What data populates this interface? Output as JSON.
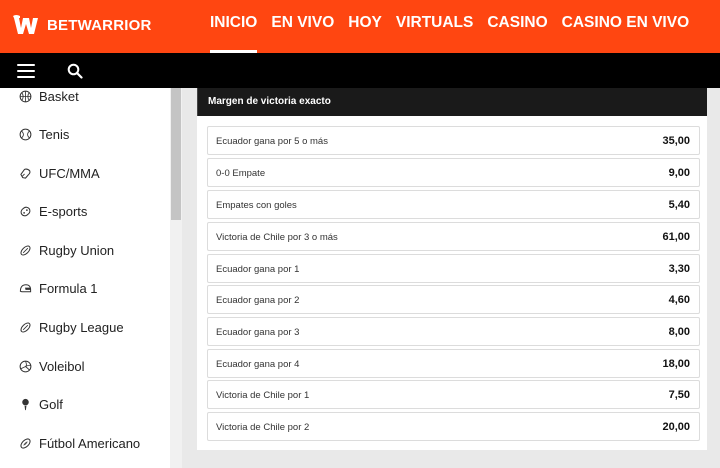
{
  "header": {
    "brand": "BETWARRIOR",
    "nav": [
      {
        "label": "INICIO",
        "active": true
      },
      {
        "label": "EN VIVO",
        "active": false
      },
      {
        "label": "HOY",
        "active": false
      },
      {
        "label": "VIRTUALS",
        "active": false
      },
      {
        "label": "CASINO",
        "active": false
      },
      {
        "label": "CASINO EN VIVO",
        "active": false
      }
    ],
    "colors": {
      "brand": "#ff4611",
      "subbar": "#000000"
    }
  },
  "toolbar": {
    "menu_icon": "hamburger-icon",
    "search_icon": "search-icon"
  },
  "sidebar": {
    "items": [
      {
        "label": "Basket",
        "icon": "basketball-icon"
      },
      {
        "label": "Tenis",
        "icon": "tennis-ball-icon"
      },
      {
        "label": "UFC/MMA",
        "icon": "glove-icon"
      },
      {
        "label": "E-sports",
        "icon": "gamepad-icon"
      },
      {
        "label": "Rugby Union",
        "icon": "rugby-ball-icon"
      },
      {
        "label": "Formula 1",
        "icon": "helmet-icon"
      },
      {
        "label": "Rugby League",
        "icon": "rugby-ball-icon"
      },
      {
        "label": "Voleibol",
        "icon": "volleyball-icon"
      },
      {
        "label": "Golf",
        "icon": "golf-tee-icon"
      },
      {
        "label": "Fútbol Americano",
        "icon": "american-football-icon"
      }
    ]
  },
  "market": {
    "title": "Margen de victoria exacto",
    "odds": [
      {
        "label": "Ecuador gana por 5 o más",
        "value": "35,00"
      },
      {
        "label": "0-0 Empate",
        "value": "9,00"
      },
      {
        "label": "Empates con goles",
        "value": "5,40"
      },
      {
        "label": "Victoria de Chile por 3 o más",
        "value": "61,00"
      },
      {
        "label": "Ecuador gana por 1",
        "value": "3,30"
      },
      {
        "label": "Ecuador gana por 2",
        "value": "4,60"
      },
      {
        "label": "Ecuador gana por 3",
        "value": "8,00"
      },
      {
        "label": "Ecuador gana por 4",
        "value": "18,00"
      },
      {
        "label": "Victoria de Chile por 1",
        "value": "7,50"
      },
      {
        "label": "Victoria de Chile por 2",
        "value": "20,00"
      }
    ]
  }
}
